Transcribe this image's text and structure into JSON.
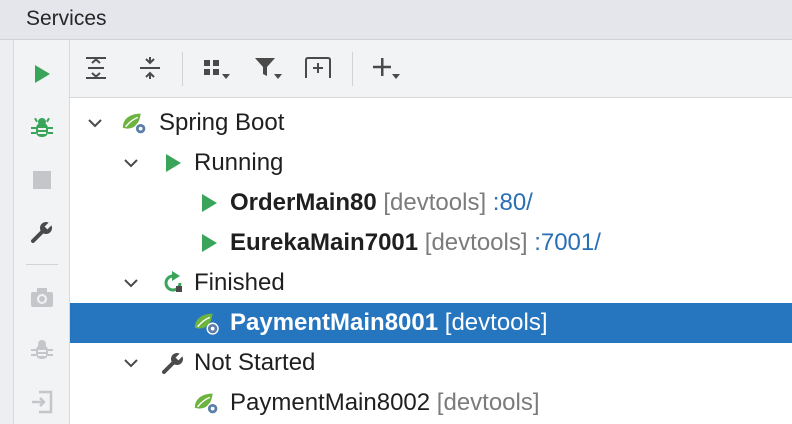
{
  "window": {
    "title": "Services"
  },
  "left_toolbar": {
    "buttons": [
      {
        "icon": "run-icon",
        "enabled": true
      },
      {
        "icon": "debug-icon",
        "enabled": true
      },
      {
        "icon": "stop-icon",
        "enabled": false
      },
      {
        "icon": "wrench-icon",
        "enabled": true
      },
      {
        "icon": "camera-icon",
        "enabled": false
      },
      {
        "icon": "debug-disabled-icon",
        "enabled": false
      },
      {
        "icon": "exit-icon",
        "enabled": false
      }
    ]
  },
  "top_toolbar": {
    "buttons": [
      {
        "icon": "expand-all-icon"
      },
      {
        "icon": "collapse-all-icon"
      },
      {
        "icon": "group-by-icon"
      },
      {
        "icon": "filter-icon"
      },
      {
        "icon": "new-tab-icon"
      },
      {
        "icon": "add-service-icon"
      }
    ]
  },
  "tree": {
    "root": {
      "label": "Spring Boot",
      "icon": "spring-boot-icon"
    },
    "running": {
      "label": "Running",
      "items": [
        {
          "name": "OrderMain80",
          "tag": "[devtools]",
          "port": ":80/"
        },
        {
          "name": "EurekaMain7001",
          "tag": "[devtools]",
          "port": ":7001/"
        }
      ]
    },
    "finished": {
      "label": "Finished",
      "items": [
        {
          "name": "PaymentMain8001",
          "tag": "[devtools]",
          "selected": true
        }
      ]
    },
    "not_started": {
      "label": "Not Started",
      "items": [
        {
          "name": "PaymentMain8002",
          "tag": "[devtools]"
        }
      ]
    }
  },
  "colors": {
    "run_green": "#3aa55a",
    "selection_blue": "#2675bf",
    "port_link_blue": "#2a6fb5",
    "tag_gray": "#7b7b7b"
  }
}
